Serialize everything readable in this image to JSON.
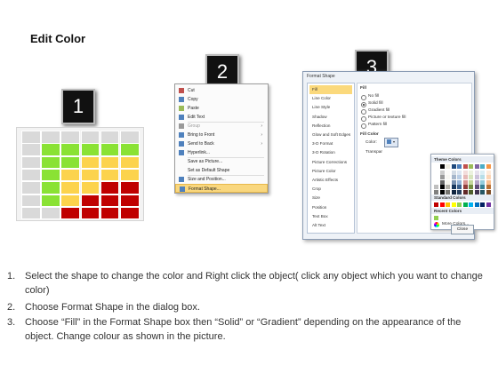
{
  "title": "Edit Color",
  "steps": [
    "1",
    "2",
    "3"
  ],
  "colors": {
    "green": "#8ae234",
    "yellow": "#fcd34d",
    "red": "#c00000",
    "gray": "#d9d9d9",
    "highlight": "#f9d77e"
  },
  "grid": {
    "rows": [
      [
        "gray",
        "gray",
        "gray",
        "gray",
        "gray",
        "gray"
      ],
      [
        "gray",
        "green",
        "green",
        "green",
        "green",
        "green"
      ],
      [
        "gray",
        "green",
        "green",
        "yellow",
        "yellow",
        "yellow"
      ],
      [
        "gray",
        "green",
        "yellow",
        "yellow",
        "yellow",
        "yellow"
      ],
      [
        "gray",
        "green",
        "yellow",
        "yellow",
        "red",
        "red"
      ],
      [
        "gray",
        "green",
        "yellow",
        "red",
        "red",
        "red"
      ],
      [
        "gray",
        "gray",
        "red",
        "red",
        "red",
        "red"
      ]
    ]
  },
  "context_menu": {
    "items": [
      {
        "label": "Cut",
        "icon": "scissors-icon",
        "dim": false,
        "submenu": false
      },
      {
        "label": "Copy",
        "icon": "copy-icon",
        "dim": false,
        "submenu": false
      },
      {
        "label": "Paste",
        "icon": "paste-icon",
        "dim": false,
        "submenu": false
      },
      {
        "label": "Edit Text",
        "icon": "edit-text-icon",
        "dim": false,
        "submenu": false
      },
      {
        "label": "Group",
        "icon": "group-icon",
        "dim": true,
        "submenu": true
      },
      {
        "label": "Bring to Front",
        "icon": "bring-front-icon",
        "dim": false,
        "submenu": true
      },
      {
        "label": "Send to Back",
        "icon": "send-back-icon",
        "dim": false,
        "submenu": true
      },
      {
        "label": "Hyperlink...",
        "icon": "hyperlink-icon",
        "dim": false,
        "submenu": false
      },
      {
        "label": "Save as Picture...",
        "icon": "",
        "dim": false,
        "submenu": false
      },
      {
        "label": "Set as Default Shape",
        "icon": "",
        "dim": false,
        "submenu": false
      },
      {
        "label": "Size and Position...",
        "icon": "size-icon",
        "dim": false,
        "submenu": false
      },
      {
        "label": "Format Shape...",
        "icon": "format-shape-icon",
        "dim": false,
        "submenu": false
      }
    ]
  },
  "format_dialog": {
    "title": "Format Shape",
    "categories": [
      "Fill",
      "Line Color",
      "Line Style",
      "Shadow",
      "Reflection",
      "Glow and Soft Edges",
      "3-D Format",
      "3-D Rotation",
      "Picture Corrections",
      "Picture Color",
      "Artistic Effects",
      "Crop",
      "Size",
      "Position",
      "Text Box",
      "Alt Text"
    ],
    "fill_heading": "Fill",
    "options": [
      "No fill",
      "Solid fill",
      "Gradient fill",
      "Picture or texture fill",
      "Pattern fill"
    ],
    "fill_color_label": "Fill Color",
    "color_label": "Color:",
    "transparency_label": "Transpar",
    "close_label": "Close",
    "popup": {
      "theme_colors": "Theme Colors",
      "standard_colors": "Standard Colors",
      "recent_colors": "Recent Colors",
      "more_colors": "More Colors..."
    },
    "theme_palette": [
      "#ffffff",
      "#000000",
      "#eeece1",
      "#1f497d",
      "#4f81bd",
      "#c0504d",
      "#9bbb59",
      "#8064a2",
      "#4bacc6",
      "#f79646"
    ],
    "standard_palette": [
      "#c00000",
      "#ff0000",
      "#ffc000",
      "#ffff00",
      "#92d050",
      "#00b050",
      "#00b0f0",
      "#0070c0",
      "#002060",
      "#7030a0"
    ]
  },
  "instructions": [
    {
      "num": "1.",
      "text": "Select the shape to change the color and Right click the object( click any object which you want to change color)"
    },
    {
      "num": "2.",
      "text": "Choose Format Shape in the dialog box."
    },
    {
      "num": "3.",
      "text": "Choose “Fill” in the Format Shape box then “Solid” or “Gradient” depending on the appearance of the object. Change colour as shown in the picture."
    }
  ]
}
